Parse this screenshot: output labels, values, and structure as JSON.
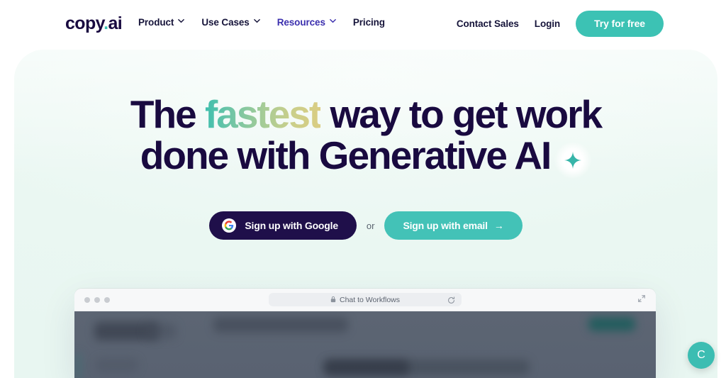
{
  "brand": {
    "name_main": "copy",
    "name_dot": ".",
    "name_suffix": "ai",
    "logo_color": "#190a40",
    "accent_color": "#3cc2b4"
  },
  "nav": {
    "items": [
      {
        "label": "Product",
        "has_chevron": true,
        "icon": "chevron-down-icon"
      },
      {
        "label": "Use Cases",
        "has_chevron": true,
        "icon": "chevron-down-icon"
      },
      {
        "label": "Resources",
        "has_chevron": true,
        "icon": "chevron-down-icon"
      },
      {
        "label": "Pricing",
        "has_chevron": false,
        "icon": ""
      }
    ],
    "contact_sales": "Contact Sales",
    "login": "Login",
    "try_for_free": "Try for free",
    "cta_color": "#3cc2b4"
  },
  "hero": {
    "headline_line1_a": "The ",
    "headline_line1_b": "fastest",
    "headline_line1_c": " way to get work",
    "headline_line2": "done with Generative AI",
    "sparkle_icon": "sparkle-icon",
    "gradient_from": "#3fbfae",
    "gradient_to": "#dacd83",
    "text_color": "#190a40",
    "background_color": "#eaf7f2"
  },
  "cta": {
    "google_label": "Sign up with Google",
    "google_icon": "google-g-icon",
    "google_bg": "#1f0f4a",
    "or_label": "or",
    "email_label": "Sign up with email",
    "email_arrow": "→",
    "email_bg": "#43c2b7"
  },
  "browser": {
    "traffic_lights": 3,
    "lock_icon": "lock-icon",
    "url_text": "Chat to Workflows",
    "reload_icon": "reload-icon",
    "expand_icon": "expand-icon",
    "body_color": "#5c6573"
  },
  "chat_widget": {
    "label": "C",
    "color": "#3cbdb2"
  }
}
